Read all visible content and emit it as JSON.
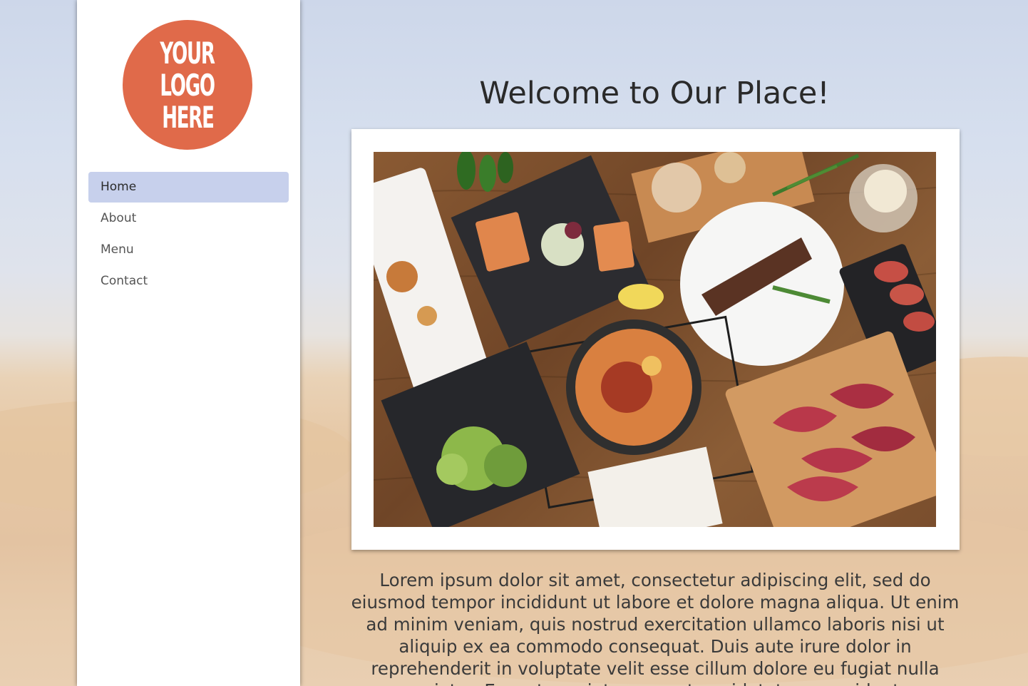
{
  "logo": {
    "lines": [
      "YOUR",
      "LOGO",
      "HERE"
    ],
    "color": "#e06a4a"
  },
  "nav": {
    "items": [
      {
        "label": "Home",
        "active": true
      },
      {
        "label": "About",
        "active": false
      },
      {
        "label": "Menu",
        "active": false
      },
      {
        "label": "Contact",
        "active": false
      }
    ],
    "active_color": "#c7d0ec"
  },
  "main": {
    "title": "Welcome to Our Place!",
    "body": "Lorem ipsum dolor sit amet, consectetur adipiscing elit, sed do eiusmod tempor incididunt ut labore et dolore magna aliqua. Ut enim ad minim veniam, quis nostrud exercitation ullamco laboris nisi ut aliquip ex ea commodo consequat. Duis aute irure dolor in reprehenderit in voluptate velit esse cillum dolore eu fugiat nulla pariatur. Excepteur sint occaecat cupidatat non proident."
  }
}
